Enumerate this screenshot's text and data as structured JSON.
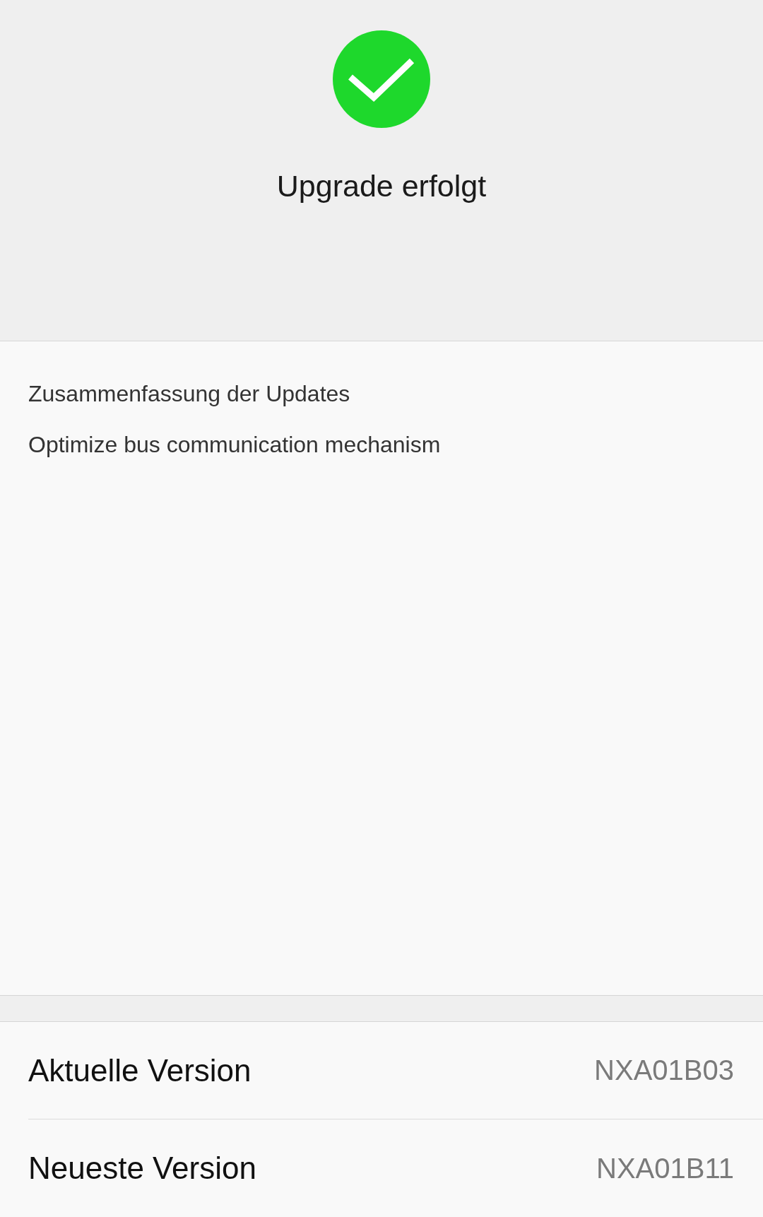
{
  "status": {
    "kind": "success",
    "title": "Upgrade erfolgt"
  },
  "summary": {
    "heading": "Zusammenfassung der Updates",
    "items": [
      "Optimize bus communication mechanism"
    ]
  },
  "versions": [
    {
      "label": "Aktuelle Version",
      "value": "NXA01B03"
    },
    {
      "label": "Neueste Version",
      "value": "NXA01B11"
    }
  ]
}
